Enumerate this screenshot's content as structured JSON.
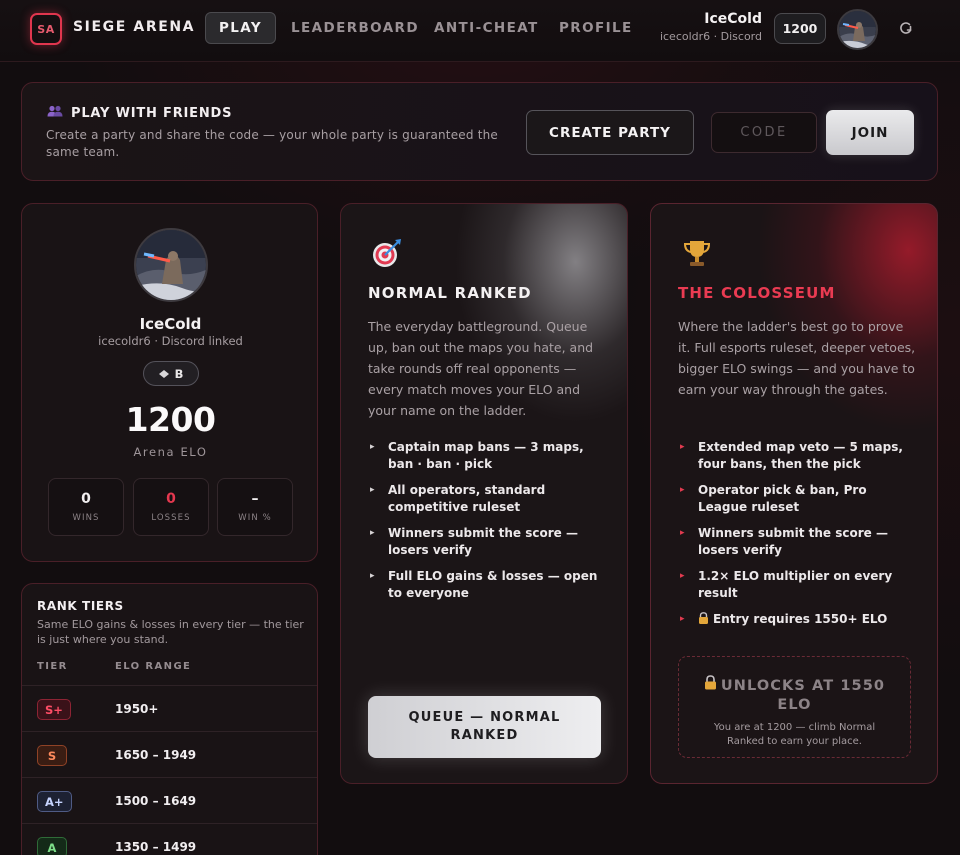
{
  "nav": {
    "logo": "SA",
    "brand": "SIEGE ARENA",
    "links": [
      "PLAY",
      "LEADERBOARD",
      "ANTI-CHEAT",
      "PROFILE"
    ],
    "active": "PLAY",
    "user_name": "IceCold",
    "user_sub": "icecoldr6 · Discord",
    "elo": "1200",
    "logout_icon": "logout-icon"
  },
  "party": {
    "title": "PLAY WITH FRIENDS",
    "desc": "Create a party and share the code — your whole party is guaranteed the same team.",
    "create_label": "CREATE PARTY",
    "code_placeholder": "CODE",
    "code_value": "",
    "join_label": "JOIN"
  },
  "profile": {
    "name": "IceCold",
    "sub": "icecoldr6 · Discord linked",
    "tier": "B",
    "elo": "1200",
    "elo_label": "Arena ELO",
    "stats": [
      {
        "value": "0",
        "label": "WINS",
        "color": "#f2eff0"
      },
      {
        "value": "0",
        "label": "LOSSES",
        "color": "#e5384f"
      },
      {
        "value": "–",
        "label": "WIN %",
        "color": "#f2eff0"
      }
    ]
  },
  "tiers": {
    "title": "RANK TIERS",
    "desc": "Same ELO gains & losses in every tier — the tier is just where you stand.",
    "col_tier": "TIER",
    "col_range": "ELO RANGE",
    "rows": [
      {
        "tier": "S+",
        "range": "1950+",
        "fg": "#ff4d66",
        "bg": "#3a1219",
        "border": "#8d2434"
      },
      {
        "tier": "S",
        "range": "1650 – 1949",
        "fg": "#ff8a5c",
        "bg": "#3a1d13",
        "border": "#8f4226"
      },
      {
        "tier": "A+",
        "range": "1500 – 1649",
        "fg": "#c7d4ff",
        "bg": "#1d2133",
        "border": "#4f5b85"
      },
      {
        "tier": "A",
        "range": "1350 – 1499",
        "fg": "#7ee08a",
        "bg": "#142a18",
        "border": "#2f6b38"
      }
    ]
  },
  "normal": {
    "icon": "target-icon",
    "title": "NORMAL RANKED",
    "desc": "The everyday battleground. Queue up, ban out the maps you hate, and take rounds off real opponents — every match moves your ELO and your name on the ladder.",
    "items": [
      "Captain map bans — 3 maps, ban · ban · pick",
      "All operators, standard competitive ruleset",
      "Winners submit the score — losers verify",
      "Full ELO gains & losses — open to everyone"
    ],
    "button": "QUEUE — NORMAL RANKED"
  },
  "colosseum": {
    "icon": "trophy-icon",
    "title": "THE COLOSSEUM",
    "desc": "Where the ladder's best go to prove it. Full esports ruleset, deeper vetoes, bigger ELO swings — and you have to earn your way through the gates.",
    "items": [
      "Extended map veto — 5 maps, four bans, then the pick",
      "Operator pick & ban, Pro League ruleset",
      "Winners submit the score — losers verify",
      "1.2× ELO multiplier on every result",
      "Entry requires 1550+ ELO"
    ],
    "unlock_title": "UNLOCKS AT 1550 ELO",
    "unlock_sub": "You are at 1200 — climb Normal Ranked to earn your place."
  }
}
